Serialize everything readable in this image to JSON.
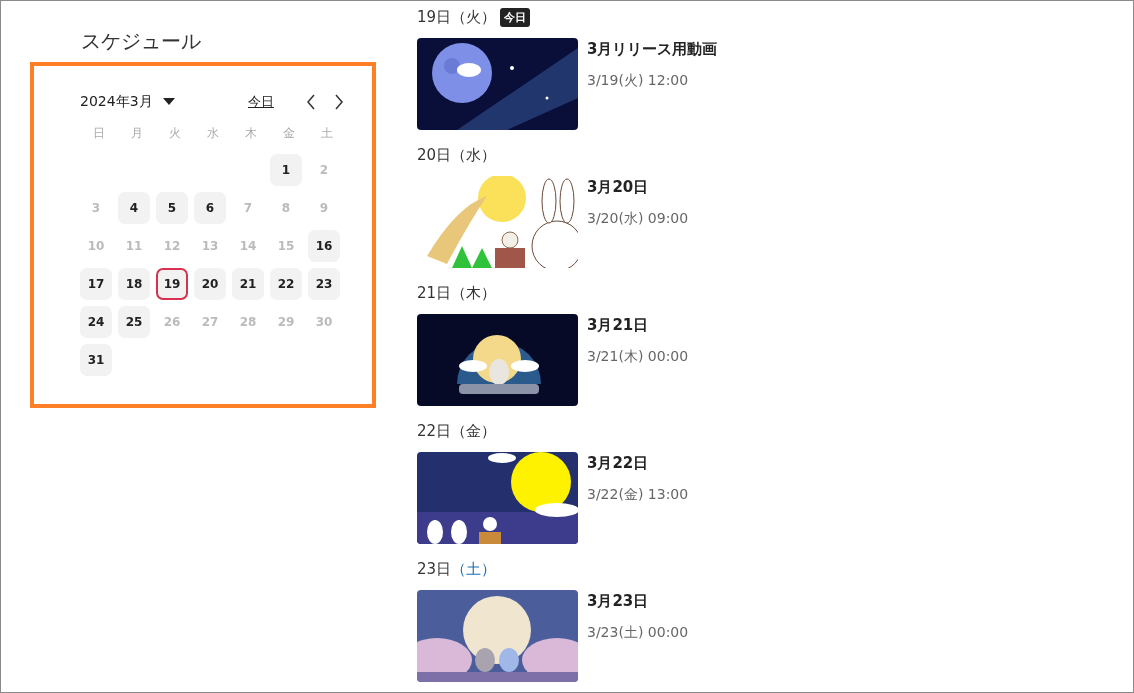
{
  "title": "スケジュール",
  "calendar": {
    "month": "2024年3月",
    "today_link": "今日",
    "weekdays": [
      "日",
      "月",
      "火",
      "水",
      "木",
      "金",
      "土"
    ],
    "weeks": [
      [
        {
          "day": "1",
          "has_event": true,
          "today": false
        },
        {
          "day": "2",
          "has_event": false,
          "today": false
        }
      ],
      [
        {
          "day": "3",
          "has_event": false,
          "today": false
        },
        {
          "day": "4",
          "has_event": true,
          "today": false
        },
        {
          "day": "5",
          "has_event": true,
          "today": false
        },
        {
          "day": "6",
          "has_event": true,
          "today": false
        },
        {
          "day": "7",
          "has_event": false,
          "today": false
        },
        {
          "day": "8",
          "has_event": false,
          "today": false
        },
        {
          "day": "9",
          "has_event": false,
          "today": false
        }
      ],
      [
        {
          "day": "10",
          "has_event": false,
          "today": false
        },
        {
          "day": "11",
          "has_event": false,
          "today": false
        },
        {
          "day": "12",
          "has_event": false,
          "today": false
        },
        {
          "day": "13",
          "has_event": false,
          "today": false
        },
        {
          "day": "14",
          "has_event": false,
          "today": false
        },
        {
          "day": "15",
          "has_event": false,
          "today": false
        },
        {
          "day": "16",
          "has_event": true,
          "today": false
        }
      ],
      [
        {
          "day": "17",
          "has_event": true,
          "today": false
        },
        {
          "day": "18",
          "has_event": true,
          "today": false
        },
        {
          "day": "19",
          "has_event": true,
          "today": true
        },
        {
          "day": "20",
          "has_event": true,
          "today": false
        },
        {
          "day": "21",
          "has_event": true,
          "today": false
        },
        {
          "day": "22",
          "has_event": true,
          "today": false
        },
        {
          "day": "23",
          "has_event": true,
          "today": false
        }
      ],
      [
        {
          "day": "24",
          "has_event": true,
          "today": false
        },
        {
          "day": "25",
          "has_event": true,
          "today": false
        },
        {
          "day": "26",
          "has_event": false,
          "today": false
        },
        {
          "day": "27",
          "has_event": false,
          "today": false
        },
        {
          "day": "28",
          "has_event": false,
          "today": false
        },
        {
          "day": "29",
          "has_event": false,
          "today": false
        },
        {
          "day": "30",
          "has_event": false,
          "today": false
        }
      ],
      [
        {
          "day": "31",
          "has_event": true,
          "today": false
        }
      ]
    ]
  },
  "agenda": [
    {
      "date": "19日",
      "weekday": "（火）",
      "saturday": false,
      "badge": "今日",
      "event": {
        "title": "3月リリース用動画",
        "time": "3/19(火) 12:00"
      }
    },
    {
      "date": "20日",
      "weekday": "（水）",
      "saturday": false,
      "event": {
        "title": "3月20日",
        "time": "3/20(水) 09:00"
      }
    },
    {
      "date": "21日",
      "weekday": "（木）",
      "saturday": false,
      "event": {
        "title": "3月21日",
        "time": "3/21(木) 00:00"
      }
    },
    {
      "date": "22日",
      "weekday": "（金）",
      "saturday": false,
      "event": {
        "title": "3月22日",
        "time": "3/22(金) 13:00"
      }
    },
    {
      "date": "23日",
      "weekday": "（土）",
      "saturday": true,
      "event": {
        "title": "3月23日",
        "time": "3/23(土) 00:00"
      }
    }
  ]
}
